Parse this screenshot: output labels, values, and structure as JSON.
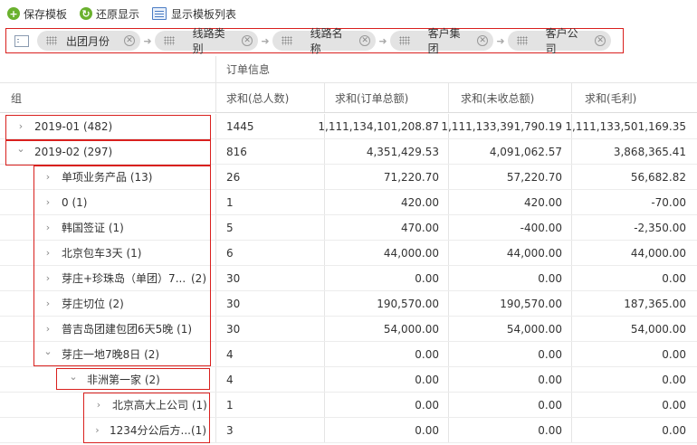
{
  "toolbar": {
    "save": "保存模板",
    "restore": "还原显示",
    "show_list": "显示模板列表"
  },
  "group_bar": {
    "chips": [
      "出团月份",
      "线路类别",
      "线路名称",
      "客户集团",
      "客户公司"
    ]
  },
  "header": {
    "group_title": "订单信息",
    "col_group": "组",
    "columns": [
      "求和(总人数)",
      "求和(订单总额)",
      "求和(未收总额)",
      "求和(毛利)"
    ]
  },
  "rows": [
    {
      "label": "2019-01 (482)",
      "expanded": false,
      "values": [
        "1445",
        "1,111,134,101,208.87",
        "1,111,133,391,790.19",
        "1,111,133,501,169.35"
      ]
    },
    {
      "label": "2019-02 (297)",
      "expanded": true,
      "values": [
        "816",
        "4,351,429.53",
        "4,091,062.57",
        "3,868,365.41"
      ]
    },
    {
      "label": "单项业务产品 (13)",
      "expanded": false,
      "values": [
        "26",
        "71,220.70",
        "57,220.70",
        "56,682.82"
      ]
    },
    {
      "label": "0 (1)",
      "expanded": false,
      "values": [
        "1",
        "420.00",
        "420.00",
        "-70.00"
      ]
    },
    {
      "label": "韩国签证 (1)",
      "expanded": false,
      "values": [
        "5",
        "470.00",
        "-400.00",
        "-2,350.00"
      ]
    },
    {
      "label": "北京包车3天 (1)",
      "expanded": false,
      "values": [
        "6",
        "44,000.00",
        "44,000.00",
        "44,000.00"
      ]
    },
    {
      "label": "芽庄+珍珠岛（单团）7...",
      "count": "(2)",
      "expanded": false,
      "values": [
        "30",
        "0.00",
        "0.00",
        "0.00"
      ]
    },
    {
      "label": "芽庄切位 (2)",
      "expanded": false,
      "values": [
        "30",
        "190,570.00",
        "190,570.00",
        "187,365.00"
      ]
    },
    {
      "label": "普吉岛团建包团6天5晚 (1)",
      "expanded": false,
      "values": [
        "30",
        "54,000.00",
        "54,000.00",
        "54,000.00"
      ]
    },
    {
      "label": "芽庄一地7晚8日 (2)",
      "expanded": true,
      "values": [
        "4",
        "0.00",
        "0.00",
        "0.00"
      ]
    },
    {
      "label": "非洲第一家 (2)",
      "expanded": true,
      "values": [
        "4",
        "0.00",
        "0.00",
        "0.00"
      ]
    },
    {
      "label": "北京高大上公司 (1)",
      "expanded": false,
      "values": [
        "1",
        "0.00",
        "0.00",
        "0.00"
      ]
    },
    {
      "label": "1234分公后方...",
      "count": "(1)",
      "expanded": false,
      "values": [
        "3",
        "0.00",
        "0.00",
        "0.00"
      ]
    }
  ]
}
